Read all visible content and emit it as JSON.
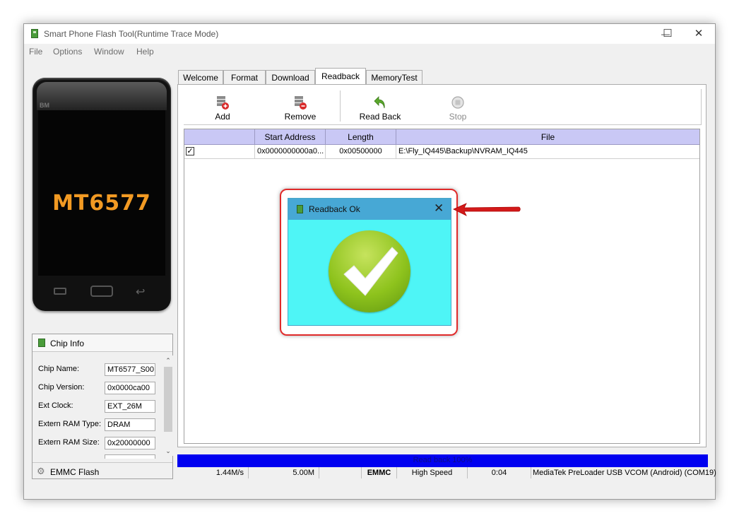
{
  "window": {
    "title": "Smart Phone Flash Tool(Runtime Trace Mode)",
    "controls": {
      "minimize": "—",
      "maximize": "☐",
      "close": "✕"
    }
  },
  "menu": [
    "File",
    "Options",
    "Window",
    "Help"
  ],
  "phone": {
    "brand": "BM",
    "chip_label": "MT6577"
  },
  "chip_info": {
    "header": "Chip Info",
    "fields": [
      {
        "label": "Chip Name:",
        "value": "MT6577_S00"
      },
      {
        "label": "Chip Version:",
        "value": "0x0000ca00"
      },
      {
        "label": "Ext Clock:",
        "value": "EXT_26M"
      },
      {
        "label": "Extern RAM Type:",
        "value": "DRAM"
      },
      {
        "label": "Extern RAM Size:",
        "value": "0x20000000"
      }
    ],
    "emmc_label": "EMMC Flash"
  },
  "tabs": [
    "Welcome",
    "Format",
    "Download",
    "Readback",
    "MemoryTest"
  ],
  "active_tab": "Readback",
  "toolbar": {
    "add": "Add",
    "remove": "Remove",
    "read_back": "Read Back",
    "stop": "Stop"
  },
  "grid": {
    "columns": [
      "",
      "Start Address",
      "Length",
      "File"
    ],
    "rows": [
      {
        "checked": true,
        "start_address": "0x0000000000a0...",
        "length": "0x00500000",
        "file": "E:\\Fly_IQ445\\Backup\\NVRAM_IQ445"
      }
    ]
  },
  "progress": {
    "text": "Read back 100%",
    "percent": 100
  },
  "status": {
    "speed": "1.44M/s",
    "size": "5.00M",
    "storage": "EMMC",
    "usb_speed": "High Speed",
    "time": "0:04",
    "port": "MediaTek PreLoader USB VCOM (Android) (COM19)"
  },
  "dialog": {
    "title": "Readback Ok",
    "close": "✕"
  },
  "colors": {
    "progress": "#0000f0",
    "dialog_bg": "#4ef5f6",
    "dialog_title": "#47a8d5",
    "highlight": "#e02a2a",
    "grid_header": "#c9c8f5"
  }
}
